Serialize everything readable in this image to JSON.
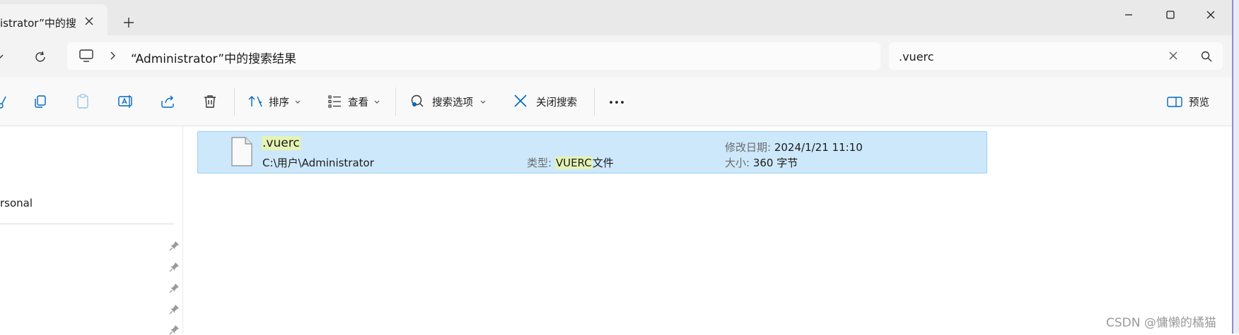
{
  "tab": {
    "title": "istrator”中的搜"
  },
  "address": {
    "path": "“Administrator”中的搜索结果"
  },
  "search": {
    "query": ".vuerc"
  },
  "toolbar": {
    "sort_label": "排序",
    "view_label": "查看",
    "search_options_label": "搜索选项",
    "close_search_label": "关闭搜索",
    "preview_label": "预览"
  },
  "nav": {
    "personal_label": "rsonal"
  },
  "result": {
    "name": ".vuerc",
    "path": "C:\\用户\\Administrator",
    "type_label": "类型:",
    "type_value": "VUERC",
    "type_suffix": "文件",
    "date_label": "修改日期:",
    "date_value": "2024/1/21 11:10",
    "size_label": "大小:",
    "size_value": "360 字节"
  },
  "watermark": "CSDN @慵懒的橘猫",
  "colors": {
    "accent": "#0067c0",
    "selection_bg": "#cde8fb",
    "selection_border": "#99d1f7",
    "highlight": "#e5f3b4"
  }
}
